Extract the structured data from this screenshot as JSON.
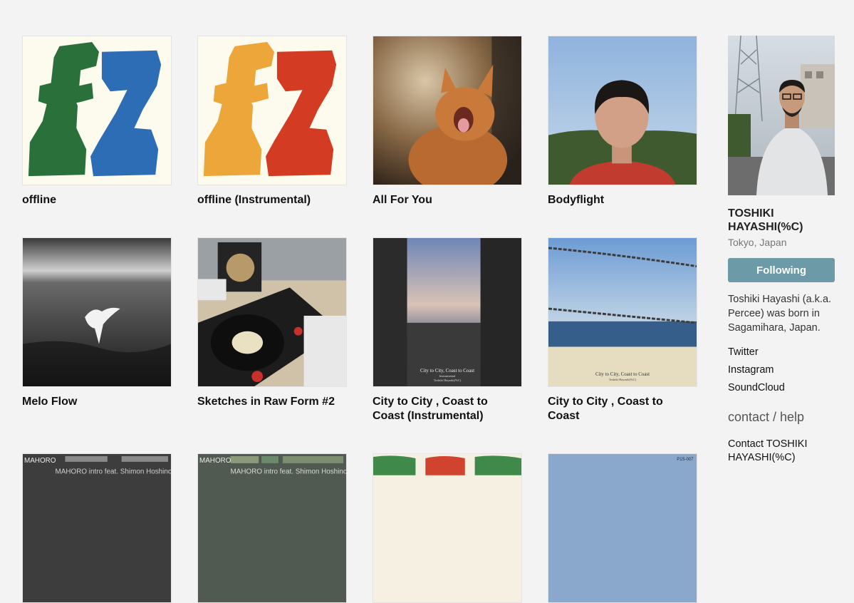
{
  "albums": [
    {
      "title": "offline"
    },
    {
      "title": "offline (Instrumental)"
    },
    {
      "title": "All For You"
    },
    {
      "title": "Bodyflight"
    },
    {
      "title": "Melo Flow"
    },
    {
      "title": "Sketches in Raw Form #2"
    },
    {
      "title": "City to City , Coast to Coast (Instrumental)"
    },
    {
      "title": "City to City , Coast to Coast"
    }
  ],
  "partial_covers": [
    {
      "label": "MAHORO",
      "sub": "MAHORO intro feat. Shimon Hoshino"
    },
    {
      "label": "MAHORO",
      "sub": "MAHORO intro feat. Shimon Hoshino"
    },
    {
      "label": ""
    },
    {
      "label": "P1S-007"
    }
  ],
  "cover_text": {
    "city_title": "City to City, Coast to Coast",
    "city_inst": "Instrumental",
    "city_artist": "Toshiki Hayashi(%C)"
  },
  "profile": {
    "name": "TOSHIKI HAYASHI(%C)",
    "location": "Tokyo, Japan",
    "follow_label": "Following",
    "bio": "Toshiki Hayashi (a.k.a. Percee) was born in Sagamihara, Japan.",
    "links": [
      {
        "label": "Twitter"
      },
      {
        "label": "Instagram"
      },
      {
        "label": "SoundCloud"
      }
    ],
    "contact_heading": "contact / help",
    "contact_link": "Contact TOSHIKI HAYASHI(%C)"
  },
  "colors": {
    "background": "#f3f3f3",
    "follow_button": "#6d9aa7",
    "green": "#2a703a",
    "blue": "#2c6db5",
    "orange": "#eca63a",
    "red": "#d33b23"
  }
}
